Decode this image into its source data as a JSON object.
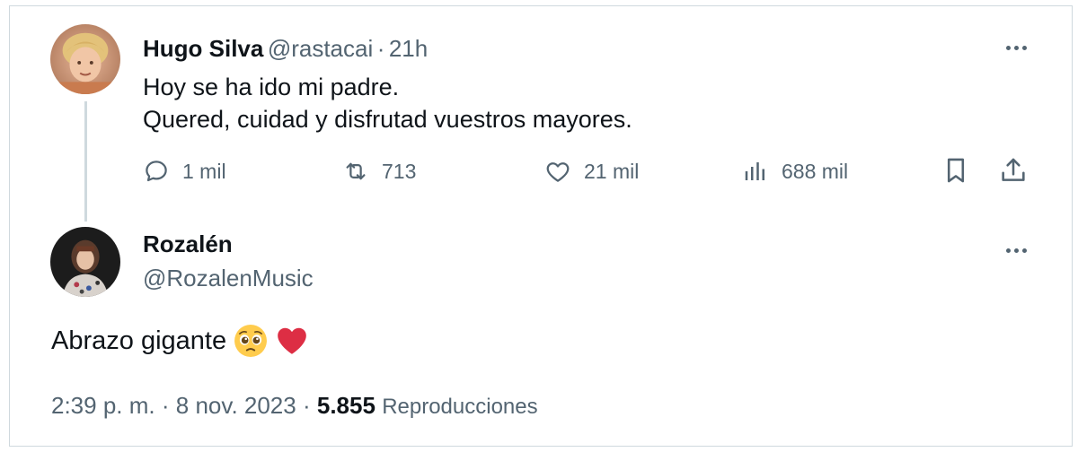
{
  "tweet": {
    "author_name": "Hugo Silva",
    "author_handle": "@rastacai",
    "separator": "·",
    "time": "21h",
    "text_lines": [
      "Hoy se ha ido mi padre.",
      "Quered, cuidad y disfrutad vuestros mayores."
    ],
    "actions": {
      "reply_count": "1 mil",
      "retweet_count": "713",
      "like_count": "21 mil",
      "views_count": "688 mil"
    }
  },
  "reply": {
    "author_name": "Rozalén",
    "author_handle": "@RozalenMusic",
    "text": "Abrazo gigante",
    "emojis": [
      "pleading-face-icon",
      "red-heart-icon"
    ],
    "footer": {
      "time": "2:39 p. m.",
      "sep1": "·",
      "date": "8 nov. 2023",
      "sep2": "·",
      "views": "5.855",
      "views_label": "Reproducciones"
    }
  },
  "colors": {
    "text": "#0f1419",
    "secondary": "#536471",
    "border": "#cfd9de",
    "heart": "#e0245e"
  }
}
